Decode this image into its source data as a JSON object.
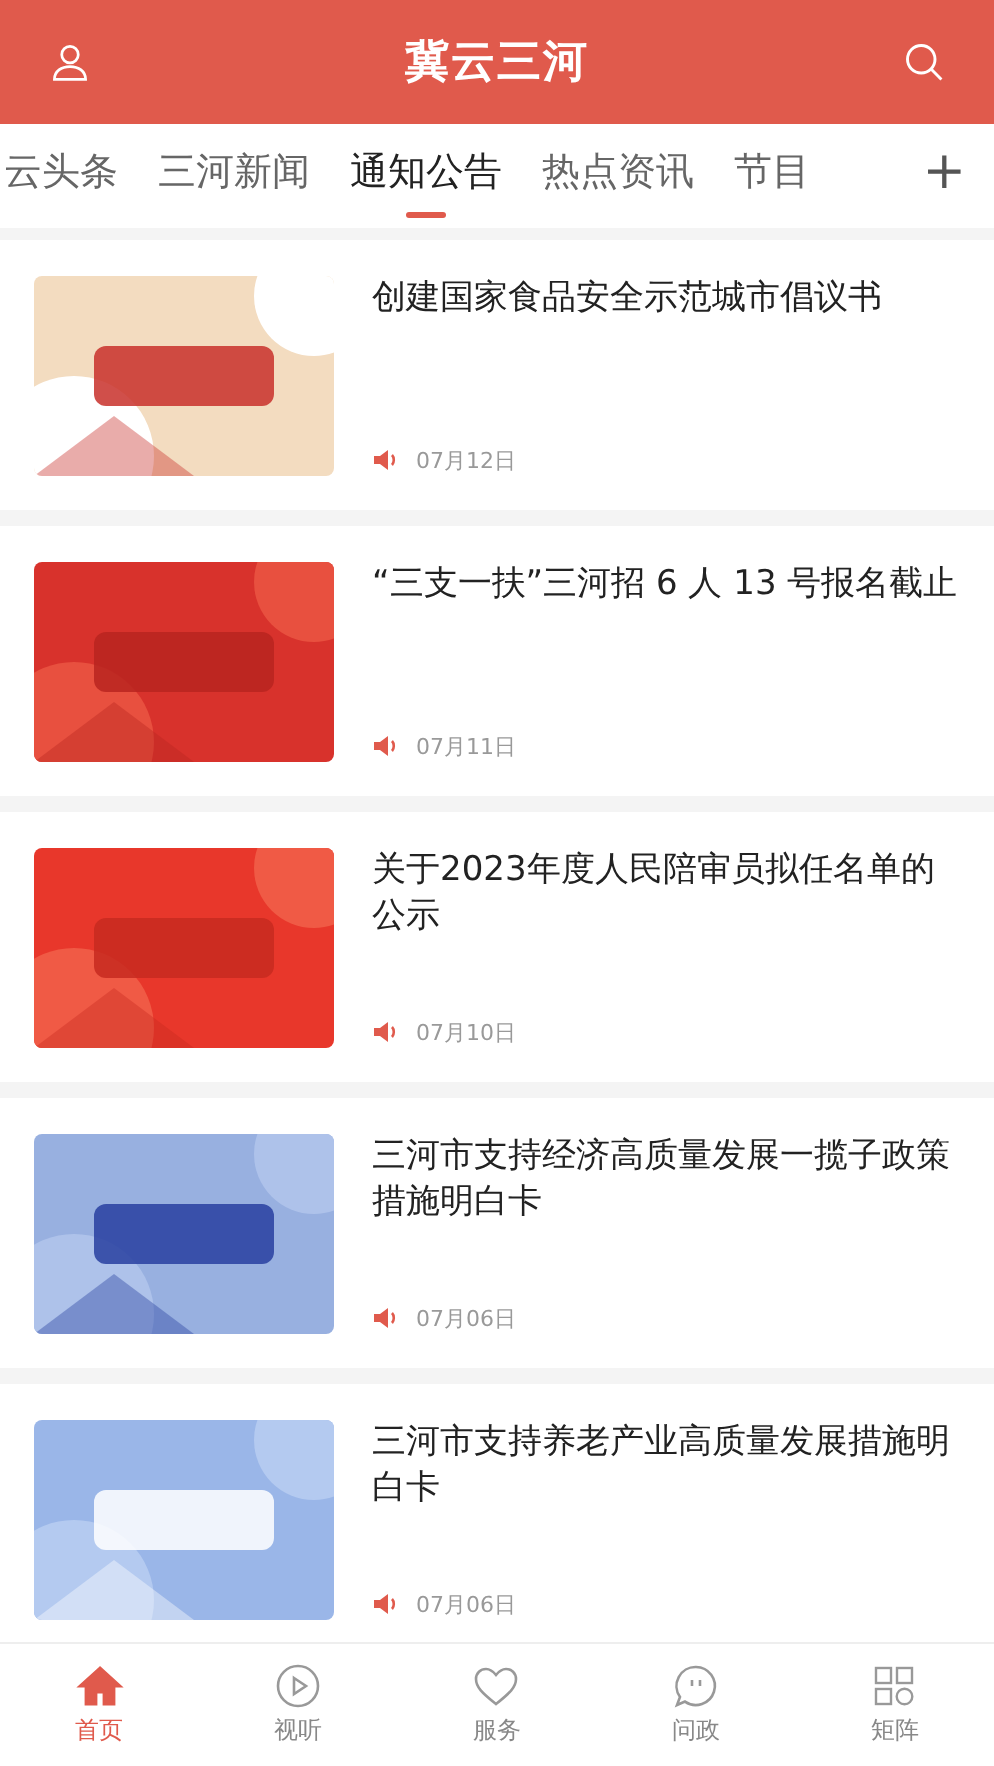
{
  "header": {
    "title": "冀云三河"
  },
  "tabs": [
    {
      "label": "云头条",
      "selected": false
    },
    {
      "label": "三河新闻",
      "selected": false
    },
    {
      "label": "通知公告",
      "selected": true
    },
    {
      "label": "热点资讯",
      "selected": false
    },
    {
      "label": "节目",
      "selected": false
    }
  ],
  "tab_more": "+",
  "articles": [
    {
      "title": "创建国家食品安全示范城市倡议书",
      "date": "07月12日"
    },
    {
      "title": "“三支一扶”三河招 6 人 13 号报名截止",
      "date": "07月11日"
    },
    {
      "title": "关于2023年度人民陪审员拟任名单的公示",
      "date": "07月10日"
    },
    {
      "title": "三河市支持经济高质量发展一揽子政策措施明白卡",
      "date": "07月06日"
    },
    {
      "title": "三河市支持养老产业高质量发展措施明白卡",
      "date": "07月06日"
    }
  ],
  "bottom_nav": [
    {
      "label": "首页",
      "kind": "home",
      "selected": true
    },
    {
      "label": "视听",
      "kind": "play",
      "selected": false
    },
    {
      "label": "服务",
      "kind": "heart",
      "selected": false
    },
    {
      "label": "问政",
      "kind": "chat",
      "selected": false
    },
    {
      "label": "矩阵",
      "kind": "grid",
      "selected": false
    }
  ]
}
